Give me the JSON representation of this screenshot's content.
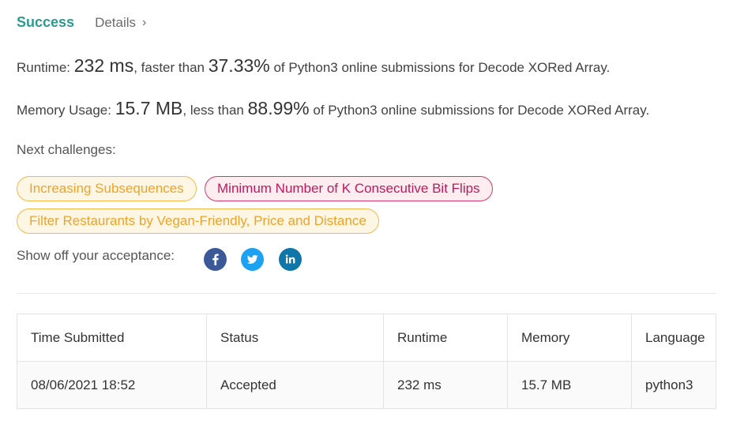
{
  "header": {
    "status": "Success",
    "details_link": "Details",
    "details_chevron": "›"
  },
  "runtime": {
    "label": "Runtime:",
    "value": "232 ms",
    "mid": ", faster than",
    "percent": "37.33%",
    "suffix": "of Python3 online submissions for Decode XORed Array."
  },
  "memory": {
    "label": "Memory Usage:",
    "value": "15.7 MB",
    "mid": ", less than",
    "percent": "88.99%",
    "suffix": "of Python3 online submissions for Decode XORed Array."
  },
  "next_challenges": {
    "label": "Next challenges:",
    "items": [
      {
        "title": "Increasing Subsequences",
        "difficulty_color": "#f0a326"
      },
      {
        "title": "Minimum Number of K Consecutive Bit Flips",
        "difficulty_color": "#c0195a"
      },
      {
        "title": "Filter Restaurants by Vegan-Friendly, Price and Distance",
        "difficulty_color": "#f0a326"
      }
    ]
  },
  "share": {
    "label": "Show off your acceptance:",
    "icons": [
      {
        "name": "facebook-icon",
        "color": "#3b5998"
      },
      {
        "name": "twitter-icon",
        "color": "#1da1f2"
      },
      {
        "name": "linkedin-icon",
        "color": "#0e76a8"
      }
    ]
  },
  "table": {
    "headers": [
      "Time Submitted",
      "Status",
      "Runtime",
      "Memory",
      "Language"
    ],
    "rows": [
      [
        "08/06/2021 18:52",
        "Accepted",
        "232 ms",
        "15.7 MB",
        "python3"
      ]
    ]
  },
  "colors": {
    "accent": "#2e9a8f",
    "medium": "#f0a326",
    "hard": "#c0195a"
  }
}
